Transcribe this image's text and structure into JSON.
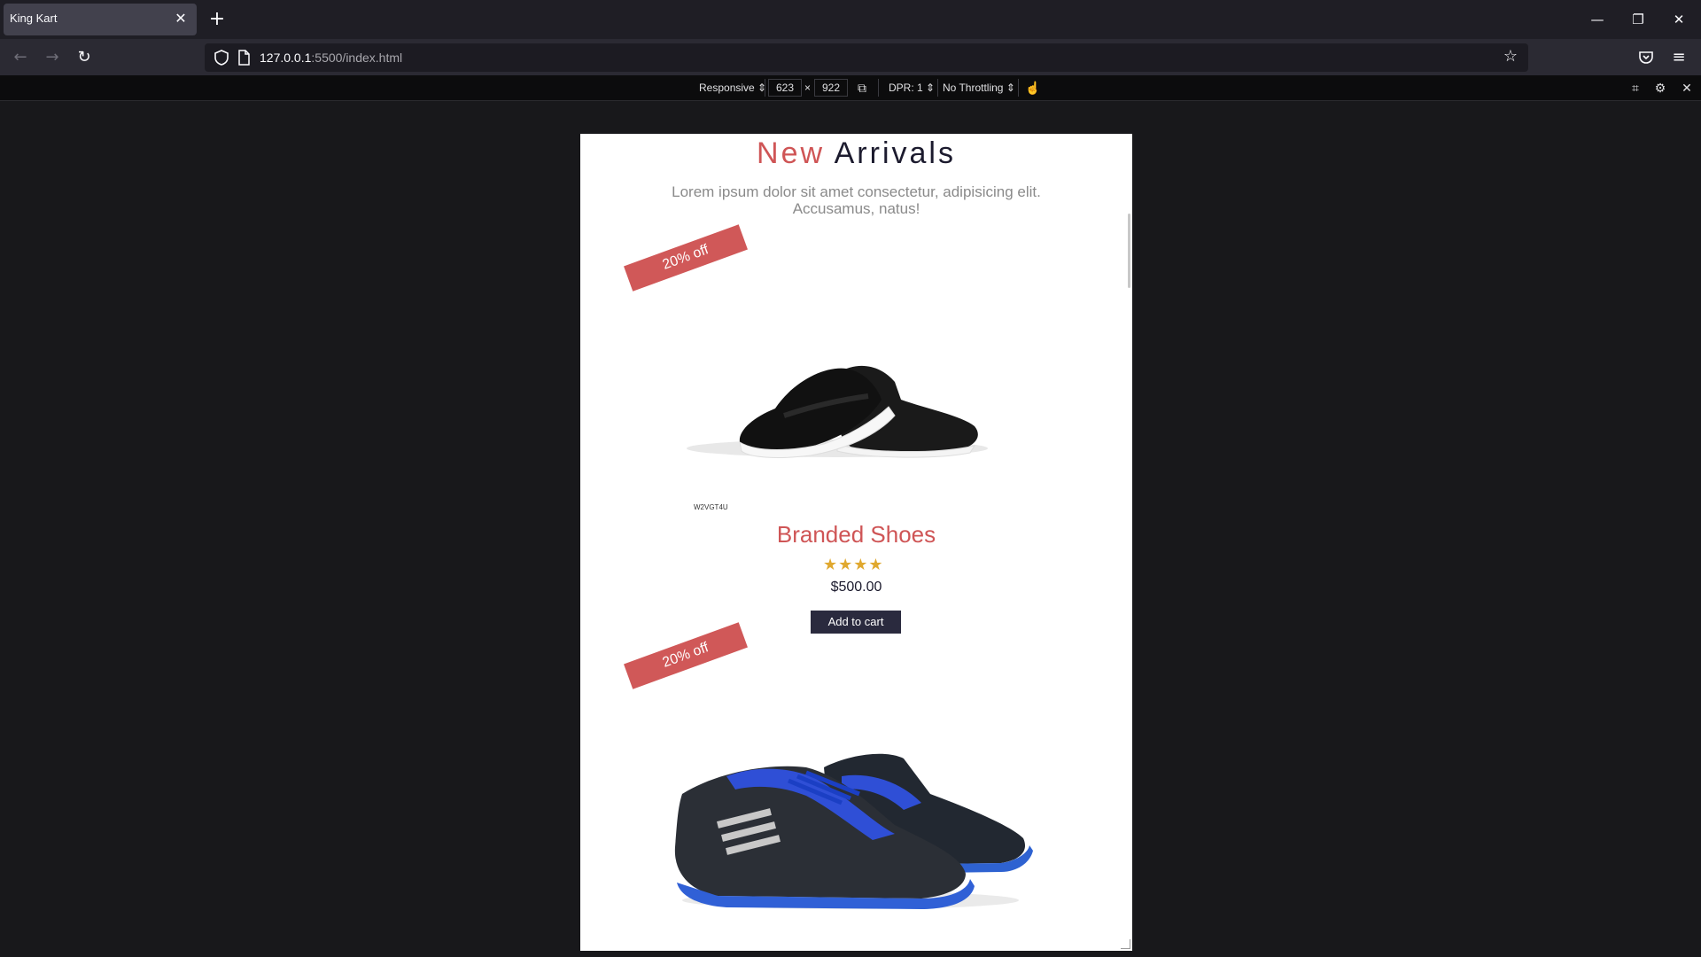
{
  "browser": {
    "tab_title": "King Kart",
    "url_host": "127.0.0.1",
    "url_rest": ":5500/index.html"
  },
  "rdm": {
    "device": "Responsive ⇕",
    "width": "623",
    "times": "×",
    "height": "922",
    "dpr": "DPR: 1 ⇕",
    "throttling": "No Throttling ⇕"
  },
  "page": {
    "heading_accent": "New",
    "heading_rest": " Arrivals",
    "subtitle": "Lorem ipsum dolor sit amet consectetur, adipisicing elit. Accusamus, natus!",
    "products": [
      {
        "badge": "20% off",
        "sku": "W2VGT4U",
        "name": "Branded Shoes",
        "stars": "★★★★",
        "price": "$500.00",
        "cart_label": "Add to cart"
      },
      {
        "badge": "20% off"
      }
    ]
  },
  "colors": {
    "accent": "#cf5556",
    "dark": "#2a2a3e",
    "star": "#e0a82e"
  }
}
